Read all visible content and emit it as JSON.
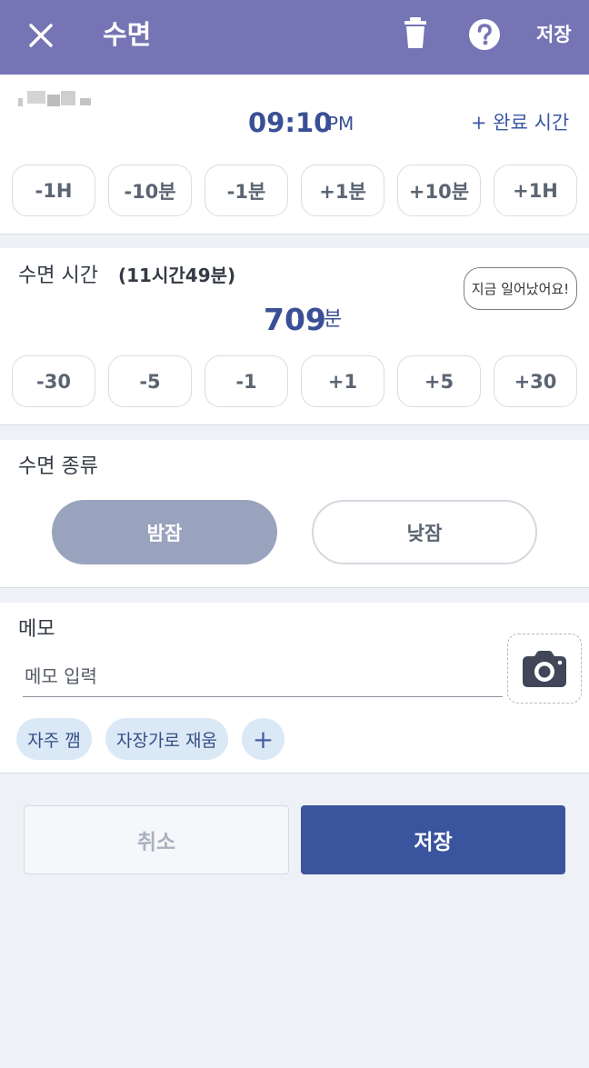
{
  "header": {
    "title": "수면",
    "save_label": "저장"
  },
  "time": {
    "value": "09:10",
    "ampm": "PM",
    "end_time_link": "+ 완료 시간",
    "adjust_buttons": [
      "-1H",
      "-10분",
      "-1분",
      "+1분",
      "+10분",
      "+1H"
    ]
  },
  "duration": {
    "label": "수면 시간",
    "summary": "(11시간49분)",
    "woke_button": "지금 일어났어요!",
    "minutes": "709",
    "unit": "분",
    "adjust_buttons": [
      "-30",
      "-5",
      "-1",
      "+1",
      "+5",
      "+30"
    ]
  },
  "sleep_type": {
    "label": "수면 종류",
    "options": [
      "밤잠",
      "낮잠"
    ],
    "selected": "밤잠"
  },
  "memo": {
    "label": "메모",
    "placeholder": "메모 입력",
    "chips": [
      "자주 깸",
      "자장가로 재움"
    ],
    "add_chip": "+"
  },
  "footer": {
    "cancel_label": "취소",
    "save_label": "저장"
  },
  "colors": {
    "header": "#7574b5",
    "accent": "#3a549d",
    "selected_option": "#9aa3bd",
    "chip": "#dbe8f6"
  }
}
